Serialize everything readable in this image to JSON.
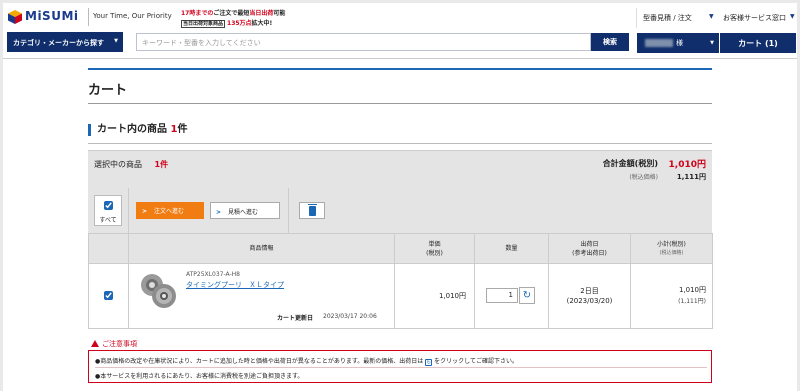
{
  "header": {
    "logo_text": "MiSUMi",
    "tagline": "Your Time, Our Priority",
    "promo_line1_part1": "17時までの",
    "promo_line1_part2": "ご注文で最短",
    "promo_line1_part3": "当日出荷",
    "promo_line1_part4": "可能",
    "promo_line2_box": "当日出荷対象商品",
    "promo_line2_part2": "135万点",
    "promo_line2_part3": "拡大中!",
    "quote_order_link": "型番見積 / 注文",
    "support_link": "お客様サービス窓口"
  },
  "nav": {
    "category_button": "カテゴリ・メーカーから探す",
    "search_placeholder": "キーワード・型番を入力してください",
    "search_button": "検索",
    "user_suffix": "様",
    "cart_button": "カート (1)"
  },
  "page": {
    "title": "カート",
    "section_title": "カート内の商品",
    "section_count": "1",
    "section_unit": "件"
  },
  "summary": {
    "selected_label": "選択中の商品",
    "selected_count": "1件",
    "total_label": "合計金額(税別)",
    "total_value": "1,010円",
    "incl_label": "(税込価格)",
    "incl_value": "1,111円"
  },
  "actions": {
    "select_all": "すべて",
    "order_button": "注文へ進む",
    "quote_button": "見積へ進む"
  },
  "table": {
    "col_product": "商品情報",
    "col_unit_price": "単価",
    "col_unit_price_sub": "(税別)",
    "col_qty": "数量",
    "col_ship": "出荷日",
    "col_ship_sub": "(参考出荷日)",
    "col_subtotal": "小計(税別)",
    "col_subtotal_sub": "(税込価格)",
    "rows": [
      {
        "code": "ATP25XL037-A-H8",
        "name": "タイミングプーリ　ＸＬタイプ",
        "updated_label": "カート更新日",
        "updated_value": "2023/03/17 20:06",
        "unit_price": "1,010円",
        "qty": "1",
        "ship_days": "2日目",
        "ship_date": "(2023/03/20)",
        "subtotal": "1,010円",
        "subtotal_incl": "(1,111円)"
      }
    ]
  },
  "notice": {
    "title": "ご注意事項",
    "line1_a": "●商品価格の改定や在庫状況により、カートに追加した時と価格や出荷日が異なることがあります。最新の価格、出荷日は",
    "line1_b": "をクリックしてご確認下さい。",
    "line2": "●本サービスを利用されるにあたり、お客様に消費税を別途ご負担頂きます。"
  }
}
